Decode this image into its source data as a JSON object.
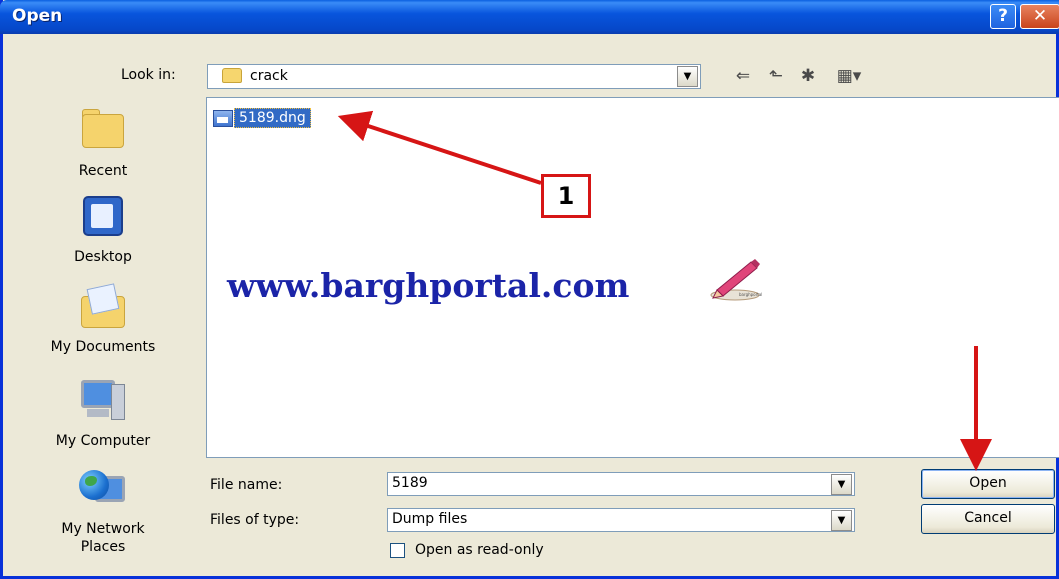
{
  "window": {
    "title": "Open",
    "help_glyph": "?",
    "close_glyph": "✕"
  },
  "toolbar": {
    "look_in_label": "Look in:",
    "look_in_value": "crack",
    "look_in_icon": "folder-icon",
    "back_icon": "back-arrow-icon",
    "up_icon": "up-one-level-icon",
    "new_folder_icon": "new-folder-icon",
    "views_icon": "views-menu-icon",
    "back_glyph": "⇐",
    "up_glyph": "⬑",
    "newfolder_glyph": "✱",
    "views_glyph": "▦▾"
  },
  "places": [
    {
      "label": "Recent",
      "icon": "recent-folder-icon"
    },
    {
      "label": "Desktop",
      "icon": "desktop-icon"
    },
    {
      "label": "My Documents",
      "icon": "my-documents-icon"
    },
    {
      "label": "My Computer",
      "icon": "my-computer-icon"
    },
    {
      "label": "My Network Places",
      "icon": "network-places-icon"
    }
  ],
  "files": [
    {
      "name": "5189.dng",
      "icon": "dng-file-icon",
      "selected": true
    }
  ],
  "overlay": {
    "watermark": "www.barghportal.com",
    "callout_number": "1",
    "annotation_color": "#d61515"
  },
  "form": {
    "file_name_label": "File name:",
    "file_name_value": "5189",
    "file_type_label": "Files of type:",
    "file_type_value": "Dump files",
    "readonly_label": "Open as read-only",
    "readonly_checked": false
  },
  "buttons": {
    "open": "Open",
    "cancel": "Cancel"
  },
  "colors": {
    "title_bar": "#0855dd",
    "dialog_bg": "#ece9d8",
    "selection": "#316ac5",
    "watermark": "#1b24a8"
  }
}
